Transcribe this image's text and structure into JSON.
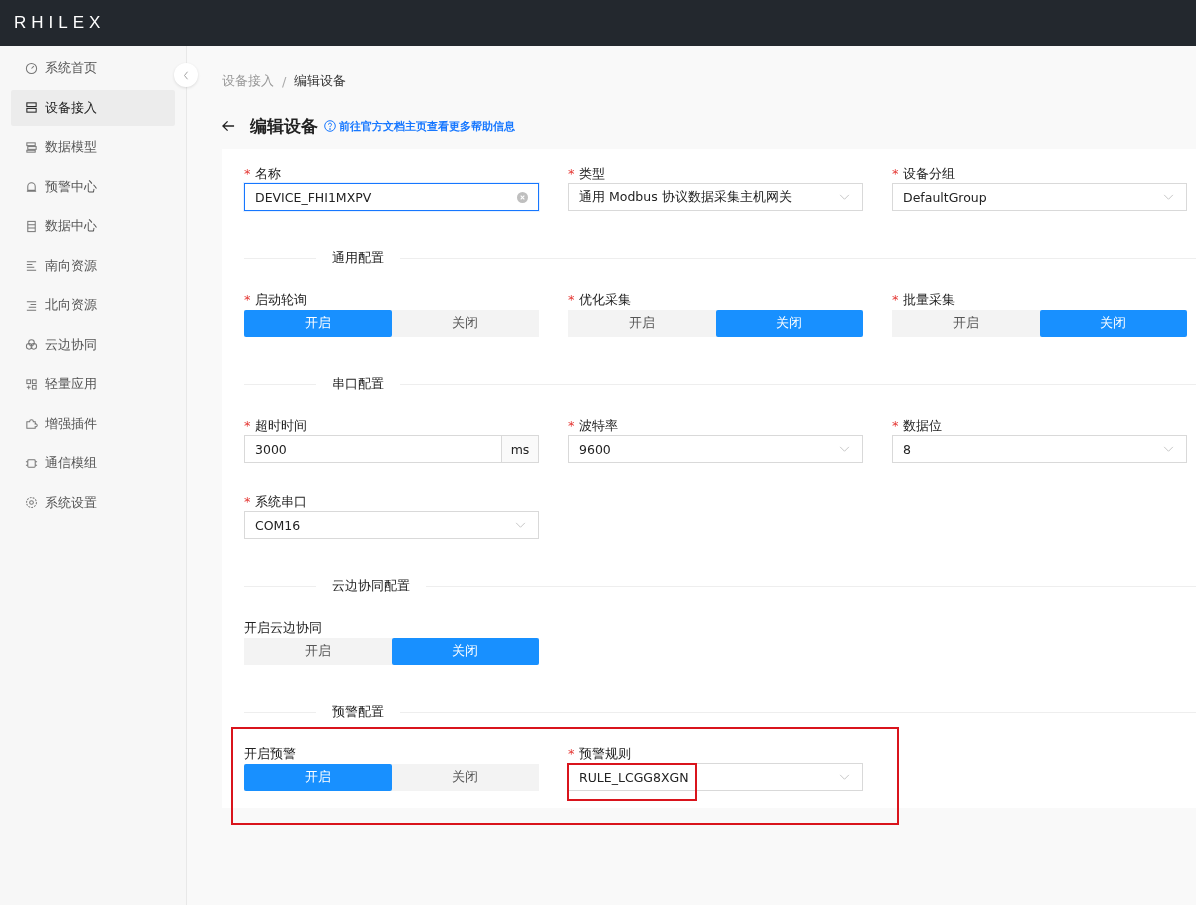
{
  "app": {
    "logo": "RHILEX"
  },
  "sidebar": {
    "items": [
      {
        "label": "系统首页",
        "selected": false
      },
      {
        "label": "设备接入",
        "selected": true
      },
      {
        "label": "数据模型",
        "selected": false
      },
      {
        "label": "预警中心",
        "selected": false
      },
      {
        "label": "数据中心",
        "selected": false
      },
      {
        "label": "南向资源",
        "selected": false
      },
      {
        "label": "北向资源",
        "selected": false
      },
      {
        "label": "云边协同",
        "selected": false
      },
      {
        "label": "轻量应用",
        "selected": false
      },
      {
        "label": "增强插件",
        "selected": false
      },
      {
        "label": "通信模组",
        "selected": false
      },
      {
        "label": "系统设置",
        "selected": false
      }
    ]
  },
  "breadcrumb": {
    "separator": "/",
    "items": [
      {
        "label": "设备接入",
        "current": false
      },
      {
        "label": "编辑设备",
        "current": true
      }
    ]
  },
  "page": {
    "title": "编辑设备",
    "help_link": "前往官方文档主页查看更多帮助信息"
  },
  "required_mark": "*",
  "sections": [
    {
      "fields": [
        {
          "kind": "input",
          "label": "名称",
          "required": true,
          "value": "DEVICE_FHI1MXPV",
          "focused": true,
          "clearable": true
        },
        {
          "kind": "select",
          "label": "类型",
          "required": true,
          "value": "通用 Modbus 协议数据采集主机网关"
        },
        {
          "kind": "select",
          "label": "设备分组",
          "required": true,
          "value": "DefaultGroup"
        }
      ]
    },
    {
      "title": "通用配置",
      "fields": [
        {
          "kind": "segmented",
          "label": "启动轮询",
          "required": true,
          "options": [
            {
              "label": "开启",
              "selected": true
            },
            {
              "label": "关闭",
              "selected": false
            }
          ]
        },
        {
          "kind": "segmented",
          "label": "优化采集",
          "required": true,
          "options": [
            {
              "label": "开启",
              "selected": false
            },
            {
              "label": "关闭",
              "selected": true
            }
          ]
        },
        {
          "kind": "segmented",
          "label": "批量采集",
          "required": true,
          "options": [
            {
              "label": "开启",
              "selected": false
            },
            {
              "label": "关闭",
              "selected": true
            }
          ]
        }
      ]
    },
    {
      "title": "串口配置",
      "fields": [
        {
          "kind": "input",
          "label": "超时时间",
          "required": true,
          "value": "3000",
          "suffix": "ms",
          "focused": false,
          "clearable": false
        },
        {
          "kind": "select",
          "label": "波特率",
          "required": true,
          "value": "9600"
        },
        {
          "kind": "select",
          "label": "数据位",
          "required": true,
          "value": "8"
        },
        {
          "kind": "select",
          "label": "系统串口",
          "required": true,
          "value": "COM16"
        }
      ]
    },
    {
      "title": "云边协同配置",
      "fields": [
        {
          "kind": "segmented",
          "label": "开启云边协同",
          "required": false,
          "options": [
            {
              "label": "开启",
              "selected": false
            },
            {
              "label": "关闭",
              "selected": true
            }
          ]
        }
      ]
    },
    {
      "title": "预警配置",
      "highlighted": true,
      "fields": [
        {
          "kind": "segmented",
          "label": "开启预警",
          "required": false,
          "options": [
            {
              "label": "开启",
              "selected": true
            },
            {
              "label": "关闭",
              "selected": false
            }
          ]
        },
        {
          "kind": "select",
          "label": "预警规则",
          "required": true,
          "highlighted": true,
          "value": "RULE_LCGG8XGN"
        }
      ]
    }
  ]
}
